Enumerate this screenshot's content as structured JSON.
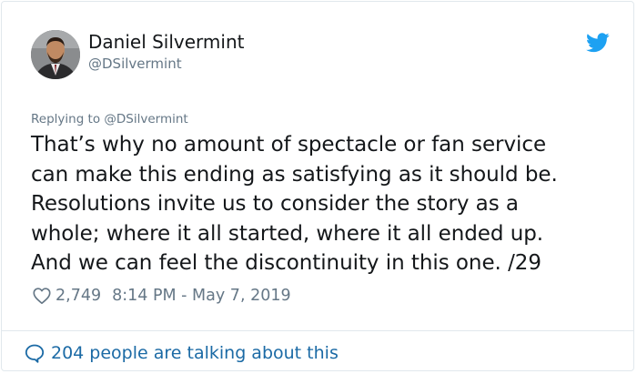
{
  "author": {
    "name": "Daniel Silvermint",
    "handle": "@DSilvermint",
    "avatar_icon": "user-avatar-photo"
  },
  "header": {
    "brand_icon": "twitter-bird-icon",
    "brand_color": "#1da1f2"
  },
  "reply": {
    "text": "Replying to @DSilvermint"
  },
  "tweet": {
    "text": "That’s why no amount of spectacle or fan service\ncan make this ending as satisfying as it should be.\nResolutions invite us to consider the story as a\nwhole; where it all started, where it all ended up.\nAnd we can feel the discontinuity in this one.  /29",
    "likes": "2,749",
    "timestamp": "8:14 PM - May 7, 2019"
  },
  "footer": {
    "talking_text": "204 people are talking about this",
    "link_color": "#1b6aa5"
  },
  "colors": {
    "text_primary": "#14171a",
    "text_secondary": "#657786",
    "border": "#e1e8ed"
  }
}
